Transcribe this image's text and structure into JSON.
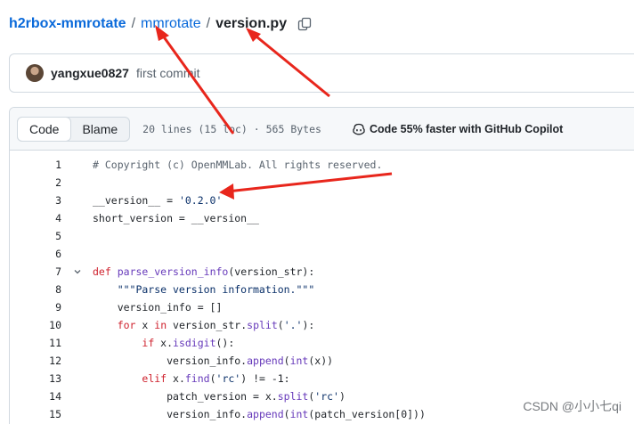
{
  "breadcrumb": {
    "repo": "h2rbox-mmrotate",
    "separator": "/",
    "folder": "mmrotate",
    "file": "version.py",
    "copy_icon": "copy-icon"
  },
  "commit": {
    "author": "yangxue0827",
    "message": "first commit",
    "avatar_icon": "avatar"
  },
  "file_header": {
    "tab_code": "Code",
    "tab_blame": "Blame",
    "meta": "20 lines (15 loc) · 565 Bytes",
    "copilot_label": "Code 55% faster with GitHub Copilot",
    "copilot_icon": "copilot-icon"
  },
  "code_lines": [
    {
      "n": "1",
      "text": "# Copyright (c) OpenMMLab. All rights reserved."
    },
    {
      "n": "2",
      "text": ""
    },
    {
      "n": "3",
      "text": "__version__ = '0.2.0'"
    },
    {
      "n": "4",
      "text": "short_version = __version__"
    },
    {
      "n": "5",
      "text": ""
    },
    {
      "n": "6",
      "text": ""
    },
    {
      "n": "7",
      "text": "def parse_version_info(version_str):"
    },
    {
      "n": "8",
      "text": "    \"\"\"Parse version information.\"\"\""
    },
    {
      "n": "9",
      "text": "    version_info = []"
    },
    {
      "n": "10",
      "text": "    for x in version_str.split('.'):"
    },
    {
      "n": "11",
      "text": "        if x.isdigit():"
    },
    {
      "n": "12",
      "text": "            version_info.append(int(x))"
    },
    {
      "n": "13",
      "text": "        elif x.find('rc') != -1:"
    },
    {
      "n": "14",
      "text": "            patch_version = x.split('rc')"
    },
    {
      "n": "15",
      "text": "            version_info.append(int(patch_version[0]))"
    }
  ],
  "watermark": "CSDN @小小七qi",
  "colors": {
    "link": "#0969da",
    "keyword": "#cf222e",
    "function": "#6639ba",
    "string": "#0a3069",
    "comment": "#59636e",
    "annotation_arrow": "#e8261c"
  }
}
